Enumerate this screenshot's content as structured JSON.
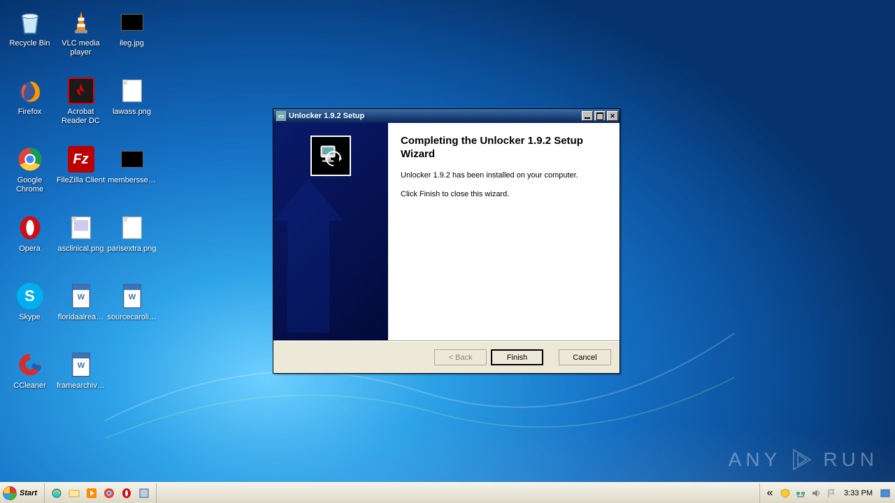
{
  "desktop_icons": [
    {
      "id": "recycle-bin",
      "label": "Recycle Bin"
    },
    {
      "id": "firefox",
      "label": "Firefox"
    },
    {
      "id": "google-chrome",
      "label": "Google Chrome"
    },
    {
      "id": "opera",
      "label": "Opera"
    },
    {
      "id": "skype",
      "label": "Skype"
    },
    {
      "id": "ccleaner",
      "label": "CCleaner"
    },
    {
      "id": "vlc",
      "label": "VLC media player"
    },
    {
      "id": "acrobat",
      "label": "Acrobat Reader DC"
    },
    {
      "id": "filezilla",
      "label": "FileZilla Client"
    },
    {
      "id": "asclinical",
      "label": "asclinical.png"
    },
    {
      "id": "floridaalrea",
      "label": "floridaalrea…"
    },
    {
      "id": "framearchiv",
      "label": "framearchiv…"
    },
    {
      "id": "ileg",
      "label": "ileg.jpg"
    },
    {
      "id": "lawass",
      "label": "lawass.png"
    },
    {
      "id": "membersse",
      "label": "membersse…"
    },
    {
      "id": "parisextra",
      "label": "parisextra.png"
    },
    {
      "id": "sourcecaroli",
      "label": "sourcecaroli…"
    }
  ],
  "window": {
    "title": "Unlocker 1.9.2 Setup",
    "heading": "Completing the Unlocker 1.9.2 Setup Wizard",
    "line1": "Unlocker 1.9.2 has been installed on your computer.",
    "line2": "Click Finish to close this wizard.",
    "buttons": {
      "back": "< Back",
      "finish": "Finish",
      "cancel": "Cancel"
    }
  },
  "taskbar": {
    "start": "Start",
    "clock": "3:33 PM"
  },
  "watermark": {
    "brand": "ANY",
    "brand2": "RUN"
  }
}
